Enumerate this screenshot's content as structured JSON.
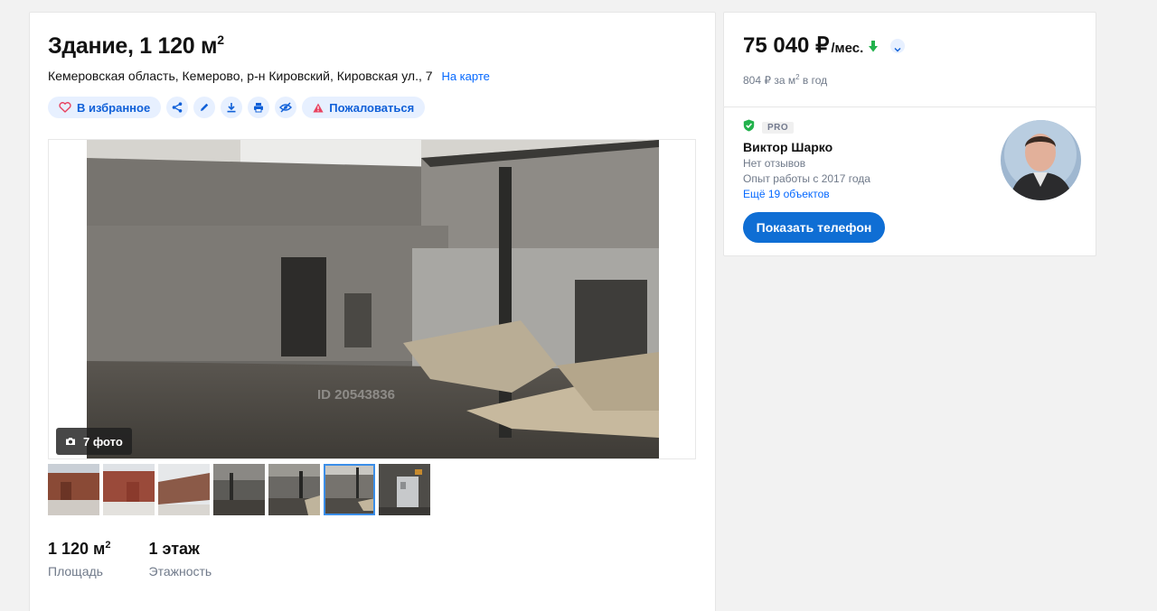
{
  "listing": {
    "title": "Здание, 1 120 м",
    "title_sup": "2",
    "address": "Кемеровская область, Кемерово, р-н Кировский, Кировская ул., 7",
    "map_link": "На карте"
  },
  "actions": {
    "favorite_label": "В избранное",
    "complain_label": "Пожаловаться",
    "icons": [
      "heart-icon",
      "share-icon",
      "edit-icon",
      "download-icon",
      "print-icon",
      "hide-icon",
      "warning-icon"
    ]
  },
  "gallery": {
    "photo_count_label": "7 фото",
    "watermark": "ID 20543836",
    "thumbnail_count": 7,
    "active_thumbnail": 6
  },
  "specs": [
    {
      "value": "1 120 м",
      "value_sup": "2",
      "label": "Площадь"
    },
    {
      "value": "1 этаж",
      "label": "Этажность"
    }
  ],
  "price": {
    "value": "75 040 ₽",
    "unit": "/мес.",
    "per_sqm": "804 ₽ за м",
    "per_sqm_sup": "2",
    "per_sqm_suffix": " в год",
    "arrow_color": "#22b24c"
  },
  "agent": {
    "pro_label": "PRO",
    "name": "Виктор Шарко",
    "reviews": "Нет отзывов",
    "experience": "Опыт работы с 2017 года",
    "more_objects": "Ещё 19 объектов",
    "show_phone": "Показать телефон",
    "verified_color": "#22b24c"
  },
  "colors": {
    "accent": "#0468ff",
    "button": "#0f6ed4",
    "pill_bg": "#e7f0ff"
  }
}
